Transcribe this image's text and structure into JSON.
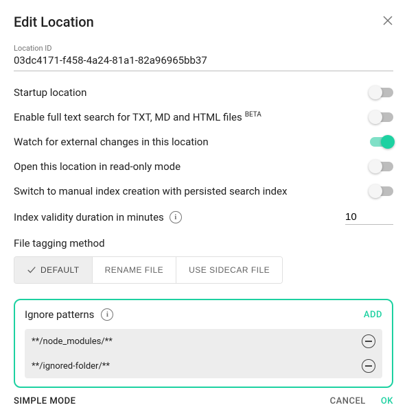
{
  "dialog": {
    "title": "Edit Location",
    "location_id_label": "Location ID",
    "location_id_value": "03dc4171-f458-4a24-81a1-82a96965bb37"
  },
  "toggles": {
    "startup": {
      "label": "Startup location",
      "on": false
    },
    "fulltext": {
      "label": "Enable full text search for TXT, MD and HTML files",
      "beta": "BETA",
      "on": false
    },
    "watch": {
      "label": "Watch for external changes in this location",
      "on": true
    },
    "readonly": {
      "label": "Open this location in read-only mode",
      "on": false
    },
    "manual_index": {
      "label": "Switch to manual index creation with persisted search index",
      "on": false
    }
  },
  "index": {
    "label": "Index validity duration in minutes",
    "value": "10"
  },
  "tagging": {
    "label": "File tagging method",
    "options": [
      "DEFAULT",
      "RENAME FILE",
      "USE SIDECAR FILE"
    ],
    "active": 0
  },
  "ignore": {
    "label": "Ignore patterns",
    "add_label": "ADD",
    "patterns": [
      "**/node_modules/**",
      "**/ignored-folder/**"
    ]
  },
  "footer": {
    "simple_mode": "SIMPLE MODE",
    "cancel": "CANCEL",
    "ok": "OK"
  }
}
